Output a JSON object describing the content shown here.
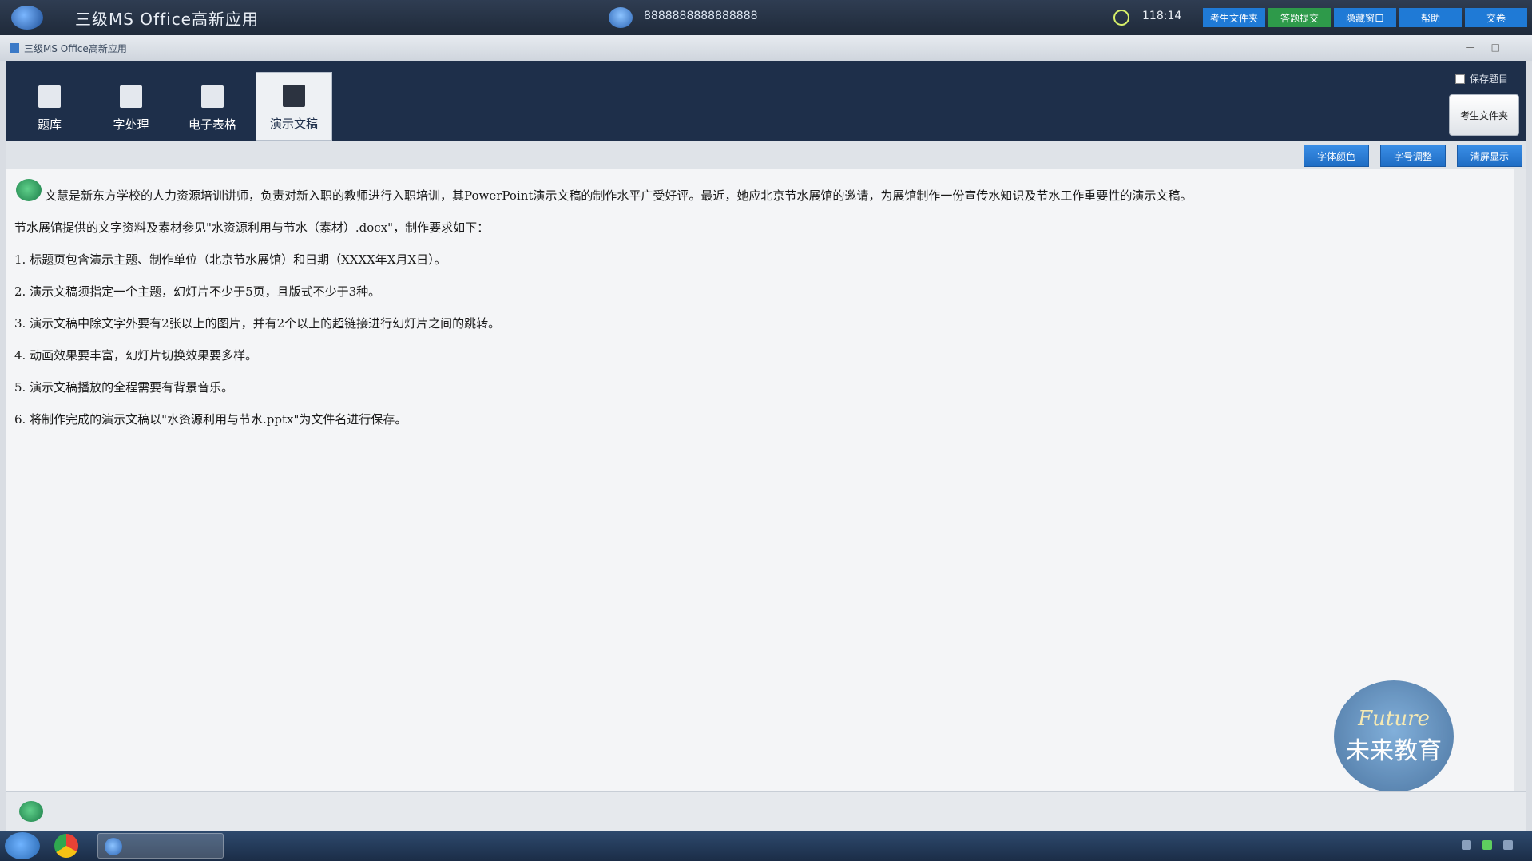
{
  "titlebar": {
    "app_title": "三级MS Office高新应用",
    "exam_id": "8888888888888888",
    "timer": "118:14",
    "buttons": [
      {
        "label": "考生文件夹",
        "color": "#1f7ad6"
      },
      {
        "label": "答题提交",
        "color": "#2e9a4a"
      },
      {
        "label": "隐藏窗口",
        "color": "#1f7ad6"
      },
      {
        "label": "帮助",
        "color": "#1f7ad6"
      },
      {
        "label": "交卷",
        "color": "#1f7ad6"
      }
    ]
  },
  "window": {
    "title": "三级MS Office高新应用"
  },
  "ribbon": {
    "tabs": [
      {
        "label": "题库"
      },
      {
        "label": "字处理"
      },
      {
        "label": "电子表格"
      },
      {
        "label": "演示文稿",
        "active": true
      }
    ],
    "checkbox_label": "保存题目",
    "folder_button": "考生文件夹"
  },
  "actions": {
    "buttons": [
      "字体颜色",
      "字号调整",
      "清屏显示"
    ]
  },
  "content": {
    "lines": [
      "文慧是新东方学校的人力资源培训讲师，负责对新入职的教师进行入职培训，其PowerPoint演示文稿的制作水平广受好评。最近，她应北京节水展馆的邀请，为展馆制作一份宣传水知识及节水工作重要性的演示文稿。",
      "节水展馆提供的文字资料及素材参见\"水资源利用与节水（素材）.docx\"，制作要求如下：",
      "1. 标题页包含演示主题、制作单位（北京节水展馆）和日期（XXXX年X月X日）。",
      "2. 演示文稿须指定一个主题，幻灯片不少于5页，且版式不少于3种。",
      "3. 演示文稿中除文字外要有2张以上的图片，并有2个以上的超链接进行幻灯片之间的跳转。",
      "4. 动画效果要丰富，幻灯片切换效果要多样。",
      "5. 演示文稿播放的全程需要有背景音乐。",
      "6. 将制作完成的演示文稿以\"水资源利用与节水.pptx\"为文件名进行保存。"
    ],
    "watermark_top": "Future",
    "watermark_bottom": "未来教育"
  }
}
